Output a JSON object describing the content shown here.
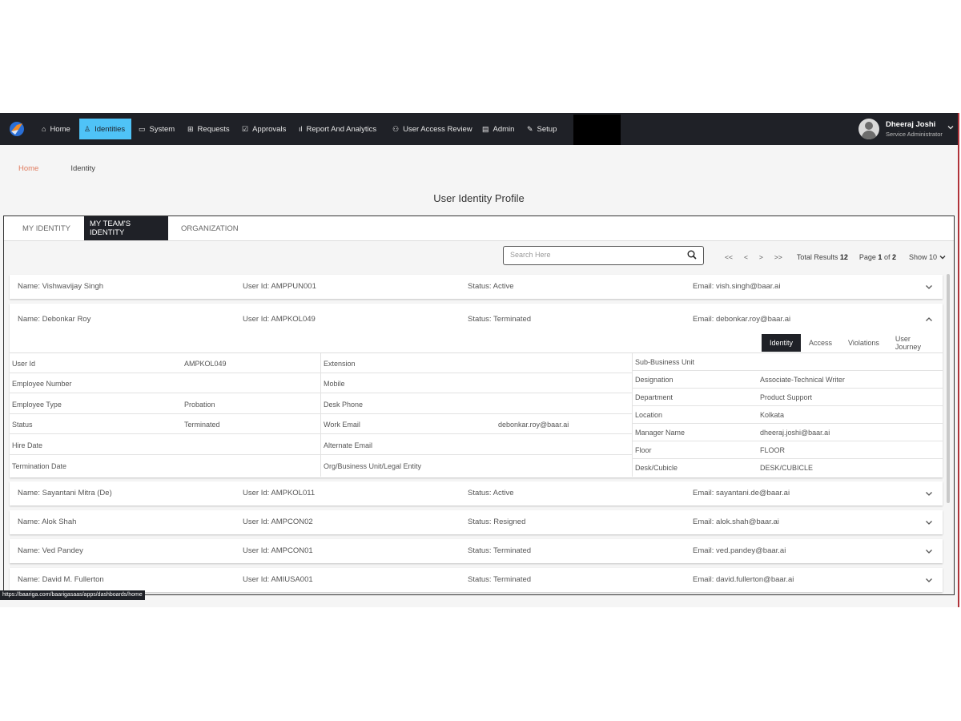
{
  "nav": {
    "items": [
      {
        "label": "Home",
        "icon": "home-icon",
        "glyph": "⌂"
      },
      {
        "label": "Identities",
        "icon": "person-icon",
        "glyph": "♙"
      },
      {
        "label": "System",
        "icon": "monitor-icon",
        "glyph": "▭"
      },
      {
        "label": "Requests",
        "icon": "grid-icon",
        "glyph": "⊞"
      },
      {
        "label": "Approvals",
        "icon": "checkbox-icon",
        "glyph": "☑"
      },
      {
        "label": "Report And Analytics",
        "icon": "bar-chart-icon",
        "glyph": "ıl"
      },
      {
        "label": "User Access Review",
        "icon": "user-review-icon",
        "glyph": "⚇"
      },
      {
        "label": "Admin",
        "icon": "server-icon",
        "glyph": "▤"
      },
      {
        "label": "Setup",
        "icon": "wrench-icon",
        "glyph": "✎"
      }
    ],
    "active": "Identities"
  },
  "user": {
    "name": "Dheeraj Joshi",
    "role": "Service Administrator"
  },
  "breadcrumb": {
    "home": "Home",
    "current": "Identity"
  },
  "page_title": "User Identity Profile",
  "tabs": [
    "MY IDENTITY",
    "MY TEAM'S IDENTITY",
    "ORGANIZATION"
  ],
  "active_tab": "MY TEAM'S IDENTITY",
  "search": {
    "placeholder": "Search Here"
  },
  "pager": {
    "first": "<<",
    "prev": "<",
    "next": ">",
    "last": ">>",
    "total_label": "Total Results",
    "total": "12",
    "page_label": "Page",
    "page": "1",
    "of_label": "of",
    "pages": "2",
    "show_label": "Show",
    "show": "10"
  },
  "rows": [
    {
      "name": "Name: Vishwavijay Singh",
      "user_id": "User Id: AMPPUN001",
      "status": "Status: Active",
      "email": "Email: vish.singh@baar.ai"
    },
    {
      "name": "Name: Debonkar Roy",
      "user_id": "User Id: AMPKOL049",
      "status": "Status: Terminated",
      "email": "Email: debonkar.roy@baar.ai"
    },
    {
      "name": "Name: Sayantani Mitra (De)",
      "user_id": "User Id: AMPKOL011",
      "status": "Status: Active",
      "email": "Email: sayantani.de@baar.ai"
    },
    {
      "name": "Name: Alok Shah",
      "user_id": "User Id: AMPCON02",
      "status": "Status: Resigned",
      "email": "Email: alok.shah@baar.ai"
    },
    {
      "name": "Name: Ved Pandey",
      "user_id": "User Id: AMPCON01",
      "status": "Status: Terminated",
      "email": "Email: ved.pandey@baar.ai"
    },
    {
      "name": "Name: David M. Fullerton",
      "user_id": "User Id: AMIUSA001",
      "status": "Status: Terminated",
      "email": "Email: david.fullerton@baar.ai"
    }
  ],
  "detail": {
    "subtabs": [
      "Identity",
      "Access",
      "Violations",
      "User Journey"
    ],
    "active_subtab": "Identity",
    "col1": [
      {
        "k": "User Id",
        "v": "AMPKOL049"
      },
      {
        "k": "Employee Number",
        "v": ""
      },
      {
        "k": "Employee Type",
        "v": "Probation"
      },
      {
        "k": "Status",
        "v": "Terminated"
      },
      {
        "k": "Hire Date",
        "v": ""
      },
      {
        "k": "Termination Date",
        "v": ""
      }
    ],
    "col2": [
      {
        "k": "Extension",
        "v": ""
      },
      {
        "k": "Mobile",
        "v": ""
      },
      {
        "k": "Desk Phone",
        "v": ""
      },
      {
        "k": "Work Email",
        "v": "debonkar.roy@baar.ai"
      },
      {
        "k": "Alternate Email",
        "v": ""
      },
      {
        "k": "Org/Business Unit/Legal Entity",
        "v": ""
      }
    ],
    "col3": [
      {
        "k": "Sub-Business Unit",
        "v": ""
      },
      {
        "k": "Designation",
        "v": "Associate-Technical Writer"
      },
      {
        "k": "Department",
        "v": "Product Support"
      },
      {
        "k": "Location",
        "v": "Kolkata"
      },
      {
        "k": "Manager Name",
        "v": "dheeraj.joshi@baar.ai"
      },
      {
        "k": "Floor",
        "v": "FLOOR"
      },
      {
        "k": "Desk/Cubicle",
        "v": "DESK/CUBICLE"
      }
    ]
  },
  "status_url": "https://baariga.com/baarigasaas/apps/dashboards/home",
  "colors": {
    "nav_bg": "#1f2127",
    "active_nav": "#4fc3f7",
    "breadcrumb_home": "#e07b5e"
  }
}
